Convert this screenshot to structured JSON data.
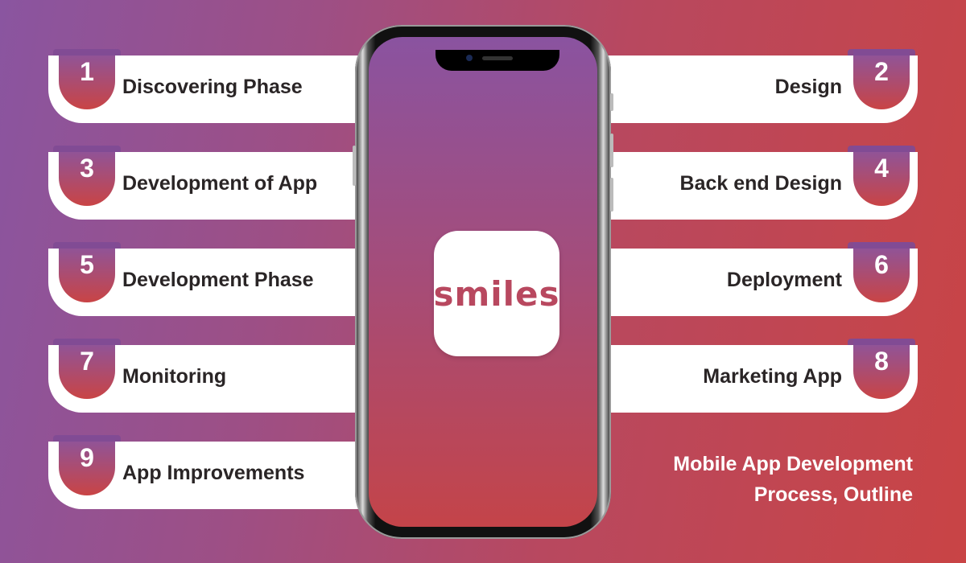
{
  "steps": [
    {
      "number": "1",
      "label": "Discovering Phase"
    },
    {
      "number": "2",
      "label": "Design"
    },
    {
      "number": "3",
      "label": "Development of App"
    },
    {
      "number": "4",
      "label": "Back end Design"
    },
    {
      "number": "5",
      "label": "Development Phase"
    },
    {
      "number": "6",
      "label": "Deployment"
    },
    {
      "number": "7",
      "label": "Monitoring"
    },
    {
      "number": "8",
      "label": "Marketing App"
    },
    {
      "number": "9",
      "label": "App Improvements"
    }
  ],
  "app": {
    "name": "smiles"
  },
  "title": {
    "line1": "Mobile App Development",
    "line2": "Process, Outline"
  },
  "colors": {
    "purple": "#8a55a0",
    "red": "#c94445",
    "text": "#2a2526"
  }
}
